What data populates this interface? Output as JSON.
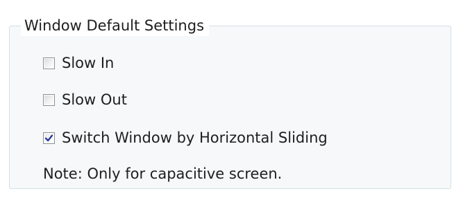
{
  "group": {
    "title": "Window Default Settings"
  },
  "options": [
    {
      "label": "Slow In",
      "checked": false
    },
    {
      "label": "Slow Out",
      "checked": false
    },
    {
      "label": "Switch Window by Horizontal Sliding",
      "checked": true
    }
  ],
  "note": "Note: Only for capacitive screen.",
  "colors": {
    "check_mark": "#2a3a9c",
    "group_border": "#d5dfe5",
    "group_background": "#f6f8fa"
  }
}
